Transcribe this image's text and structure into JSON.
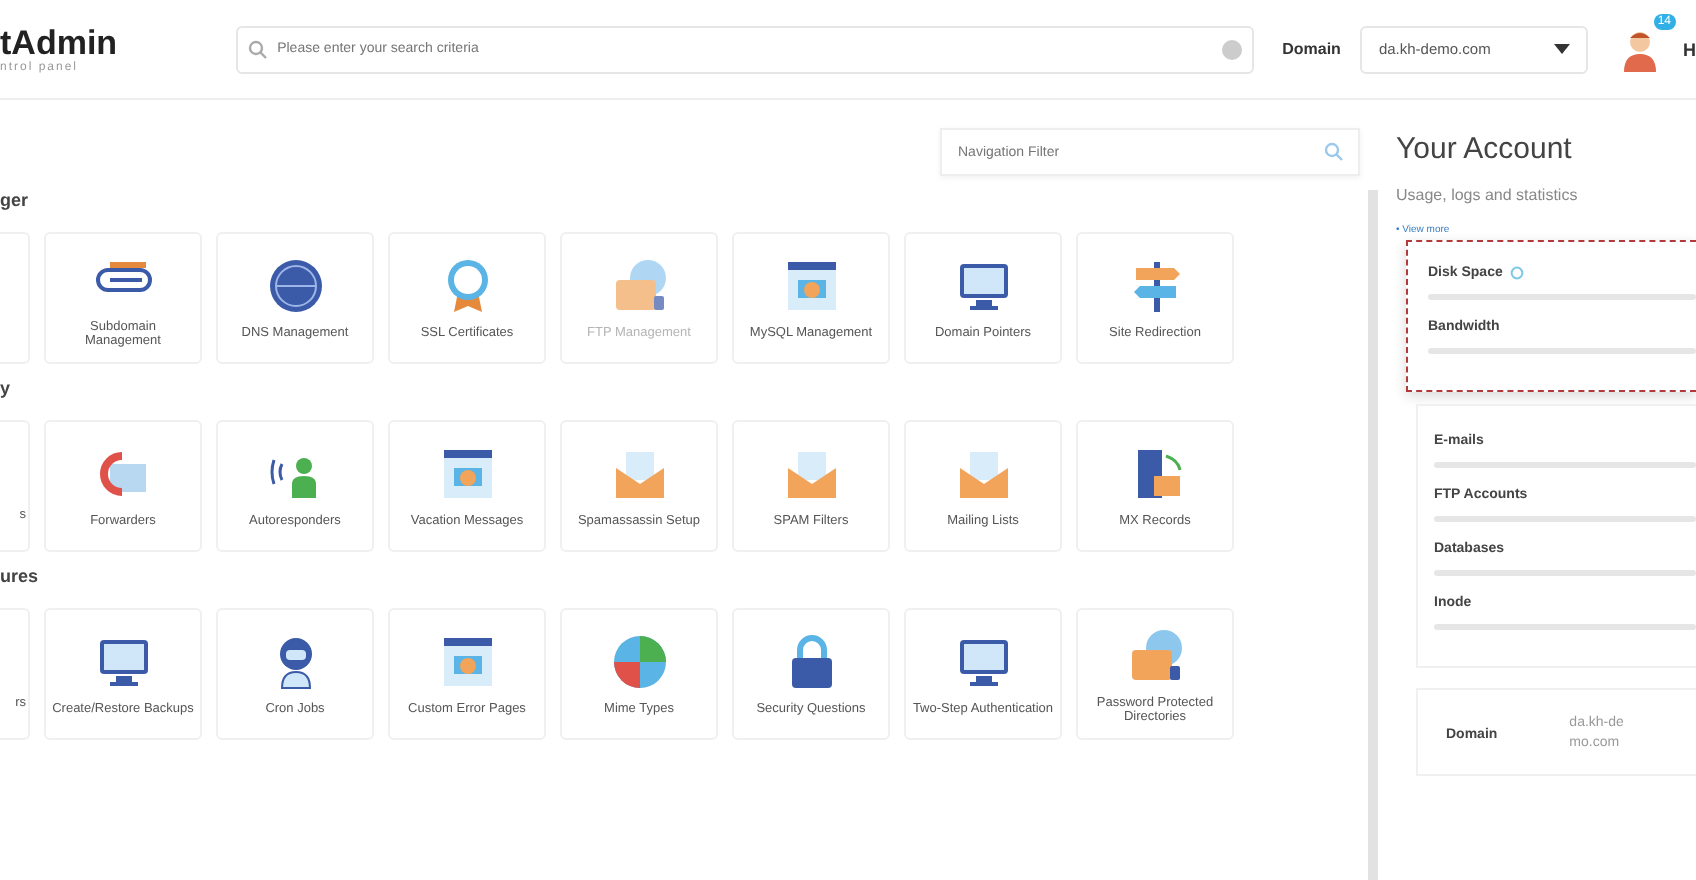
{
  "header": {
    "logo": "tAdmin",
    "logo_sub": "ntrol panel",
    "search": {
      "placeholder": "Please enter your search criteria"
    },
    "domain_label": "Domain",
    "domain_value": "da.kh-demo.com",
    "notification_count": "14",
    "user_initial": "H"
  },
  "nav_filter": {
    "placeholder": "Navigation Filter"
  },
  "sections": [
    {
      "title": "ger",
      "cards": [
        {
          "partial": true,
          "disabled": false
        },
        {
          "label": "Subdomain Management",
          "disabled": false
        },
        {
          "label": "DNS Management",
          "disabled": false
        },
        {
          "label": "SSL Certificates",
          "disabled": false
        },
        {
          "label": "FTP Management",
          "disabled": true
        },
        {
          "label": "MySQL Management",
          "disabled": false
        },
        {
          "label": "Domain Pointers",
          "disabled": false
        },
        {
          "label": "Site Redirection",
          "disabled": false
        }
      ]
    },
    {
      "title": "y",
      "cards": [
        {
          "label": "s",
          "partial": true,
          "disabled": false
        },
        {
          "label": "Forwarders",
          "disabled": false
        },
        {
          "label": "Autoresponders",
          "disabled": false
        },
        {
          "label": "Vacation Messages",
          "disabled": false
        },
        {
          "label": "Spamassassin Setup",
          "disabled": false
        },
        {
          "label": "SPAM Filters",
          "disabled": false
        },
        {
          "label": "Mailing Lists",
          "disabled": false
        },
        {
          "label": "MX Records",
          "disabled": false
        }
      ]
    },
    {
      "title": "ures",
      "cards": [
        {
          "label": "rs",
          "partial": true,
          "disabled": false
        },
        {
          "label": "Create/Restore Backups",
          "disabled": false
        },
        {
          "label": "Cron Jobs",
          "disabled": false
        },
        {
          "label": "Custom Error Pages",
          "disabled": false
        },
        {
          "label": "Mime Types",
          "disabled": false
        },
        {
          "label": "Security Questions",
          "disabled": false
        },
        {
          "label": "Two-Step Authentication",
          "disabled": false
        },
        {
          "label": "Password Protected Directories",
          "disabled": false
        }
      ]
    }
  ],
  "account": {
    "title": "Your Account",
    "subtitle": "Usage, logs and statistics",
    "view_more": "• View more",
    "usage": [
      {
        "label": "Disk Space",
        "loading": true,
        "highlighted": true
      },
      {
        "label": "Bandwidth",
        "loading": false,
        "highlighted": true
      },
      {
        "label": "E-mails",
        "loading": false,
        "highlighted": false
      },
      {
        "label": "FTP Accounts",
        "loading": false,
        "highlighted": false
      },
      {
        "label": "Databases",
        "loading": false,
        "highlighted": false
      },
      {
        "label": "Inode",
        "loading": false,
        "highlighted": false
      }
    ],
    "info": [
      {
        "label": "Domain",
        "value": "da.kh-demo.com"
      }
    ]
  }
}
